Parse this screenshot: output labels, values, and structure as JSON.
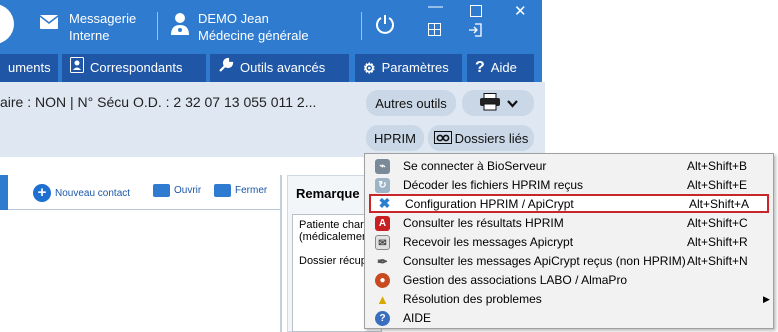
{
  "titlebar": {
    "messagerie_line1": "Messagerie",
    "messagerie_line2": "Interne",
    "user_name": "DEMO Jean",
    "user_role": "Médecine générale"
  },
  "toolbar": {
    "documents_label": "uments",
    "correspondants_label": "Correspondants",
    "outils_label": "Outils avancés",
    "parametres_label": "Paramètres",
    "aide_label": "Aide"
  },
  "patient": {
    "info_line": "aire : NON | N° Sécu O.D. : 2 32 07 13 055 011 2..."
  },
  "actions": {
    "autres_outils": "Autres outils",
    "hprim": "HPRIM",
    "dossiers_lies": "Dossiers liés"
  },
  "contacts": {
    "nouveau": "Nouveau contact",
    "ouvrir": "Ouvrir",
    "fermer": "Fermer"
  },
  "remarques": {
    "title": "Remarque",
    "line1": "Patiente charr",
    "line2": "(médicalemen",
    "line3": "Dossier récup"
  },
  "menu": {
    "items": [
      {
        "label": "Se connecter à BioServeur",
        "shortcut": "Alt+Shift+B",
        "icon": "bioserveur-icon",
        "color": "#7a8a99"
      },
      {
        "label": "Décoder les fichiers HPRIM reçus",
        "shortcut": "Alt+Shift+E",
        "icon": "decode-icon",
        "color": "#9bb5c7"
      },
      {
        "label": "Configuration HPRIM / ApiCrypt",
        "shortcut": "Alt+Shift+A",
        "icon": "tools-icon",
        "color": "#2a7fd0"
      },
      {
        "label": "Consulter les résultats HPRIM",
        "shortcut": "Alt+Shift+C",
        "icon": "pdf-icon",
        "color": "#c82020"
      },
      {
        "label": "Recevoir les messages Apicrypt",
        "shortcut": "Alt+Shift+R",
        "icon": "apicrypt-icon",
        "color": "#8a8a8a"
      },
      {
        "label": "Consulter les messages ApiCrypt reçus (non HPRIM)",
        "shortcut": "Alt+Shift+N",
        "icon": "pen-icon",
        "color": "#555555"
      },
      {
        "label": "Gestion des associations LABO / AlmaPro",
        "shortcut": "",
        "icon": "labo-icon",
        "color": "#c84a1f"
      },
      {
        "label": "Résolution des problemes",
        "shortcut": "",
        "icon": "warning-icon",
        "color": "#d9a800"
      },
      {
        "label": "AIDE",
        "shortcut": "",
        "icon": "help-icon",
        "color": "#3a6fc0"
      }
    ],
    "submenu_arrow": "▶"
  }
}
